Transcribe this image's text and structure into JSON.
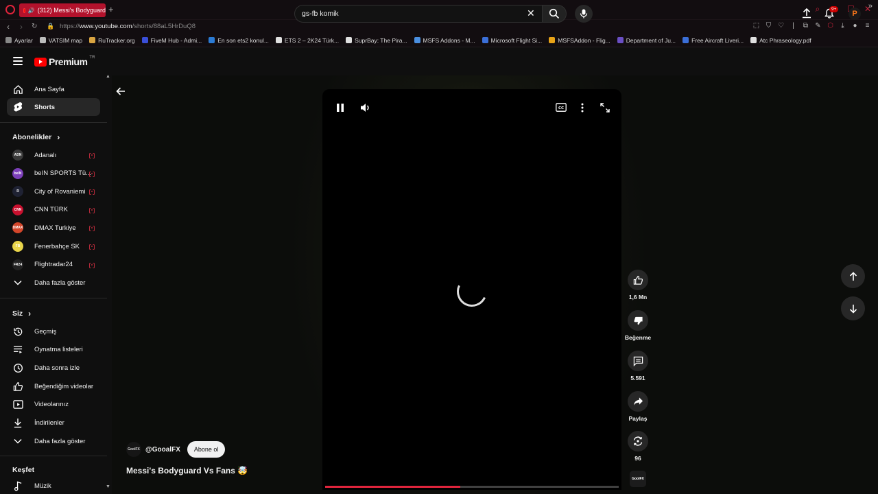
{
  "browser": {
    "tab_title": "(312) Messi's Bodyguard",
    "url_prefix": "https://",
    "url_domain": "www.youtube.com",
    "url_path": "/shorts/88aL5HrDuQ8",
    "bookmarks": [
      {
        "label": "Ayarlar",
        "color": "#888888"
      },
      {
        "label": "VATSIM map",
        "color": "#bdbdbd"
      },
      {
        "label": "RuTracker.org",
        "color": "#d9a441"
      },
      {
        "label": "FiveM Hub - Admi...",
        "color": "#3a4fd8"
      },
      {
        "label": "En son ets2 konul...",
        "color": "#2b7bd4"
      },
      {
        "label": "ETS 2 – 2K24 Türk...",
        "color": "#e0e0e0"
      },
      {
        "label": "SuprBay: The Pira...",
        "color": "#e0e0e0"
      },
      {
        "label": "MSFS Addons - M...",
        "color": "#4a8fe0"
      },
      {
        "label": "Microsoft Flight Si...",
        "color": "#3b6fd8"
      },
      {
        "label": "MSFSAddon - Flig...",
        "color": "#e8a317"
      },
      {
        "label": "Department of Ju...",
        "color": "#6a4fc4"
      },
      {
        "label": "Free Aircraft Liveri...",
        "color": "#3b6fd8"
      },
      {
        "label": "Atc Phraseology.pdf",
        "color": "#e0e0e0"
      }
    ],
    "accent": "#e0243c"
  },
  "header": {
    "logo_text": "Premium",
    "logo_region": "TR",
    "search_value": "gs-fb komik",
    "notification_badge": "9+"
  },
  "sidebar": {
    "main_items": [
      {
        "label": "Ana Sayfa"
      },
      {
        "label": "Shorts"
      }
    ],
    "subscriptions_heading": "Abonelikler",
    "subscriptions": [
      {
        "label": "Adanalı",
        "avatar_text": "ADN",
        "avatar_color": "#3a3a3a"
      },
      {
        "label": "beIN SPORTS Tü...",
        "avatar_text": "beIN",
        "avatar_color": "#7b3fb8"
      },
      {
        "label": "City of Rovaniemi",
        "avatar_text": "R",
        "avatar_color": "#1f2233"
      },
      {
        "label": "CNN TÜRK",
        "avatar_text": "CNN",
        "avatar_color": "#c8102e"
      },
      {
        "label": "DMAX Turkiye",
        "avatar_text": "DMAX",
        "avatar_color": "#d4462a"
      },
      {
        "label": "Fenerbahçe SK",
        "avatar_text": "FB",
        "avatar_color": "#e8d44a"
      },
      {
        "label": "Flightradar24",
        "avatar_text": "FR24",
        "avatar_color": "#222222"
      }
    ],
    "subs_more": "Daha fazla göster",
    "you_heading": "Siz",
    "you_items": [
      {
        "label": "Geçmiş"
      },
      {
        "label": "Oynatma listeleri"
      },
      {
        "label": "Daha sonra izle"
      },
      {
        "label": "Beğendiğim videolar"
      },
      {
        "label": "Videolarınız"
      },
      {
        "label": "İndirilenler"
      }
    ],
    "you_more": "Daha fazla göster",
    "explore_heading": "Keşfet",
    "explore_items": [
      {
        "label": "Müzik"
      }
    ]
  },
  "short": {
    "channel_handle": "@GooalFX",
    "channel_avatar_text": "GoolFX",
    "subscribe_label": "Abone ol",
    "title": "Messi's Bodyguard Vs Fans 🤯",
    "progress_fraction": 0.46,
    "loading": true,
    "likes": "1,6 Mn",
    "dislike_label": "Beğenme",
    "comments": "5.591",
    "share_label": "Paylaş",
    "remix_count": "96"
  }
}
